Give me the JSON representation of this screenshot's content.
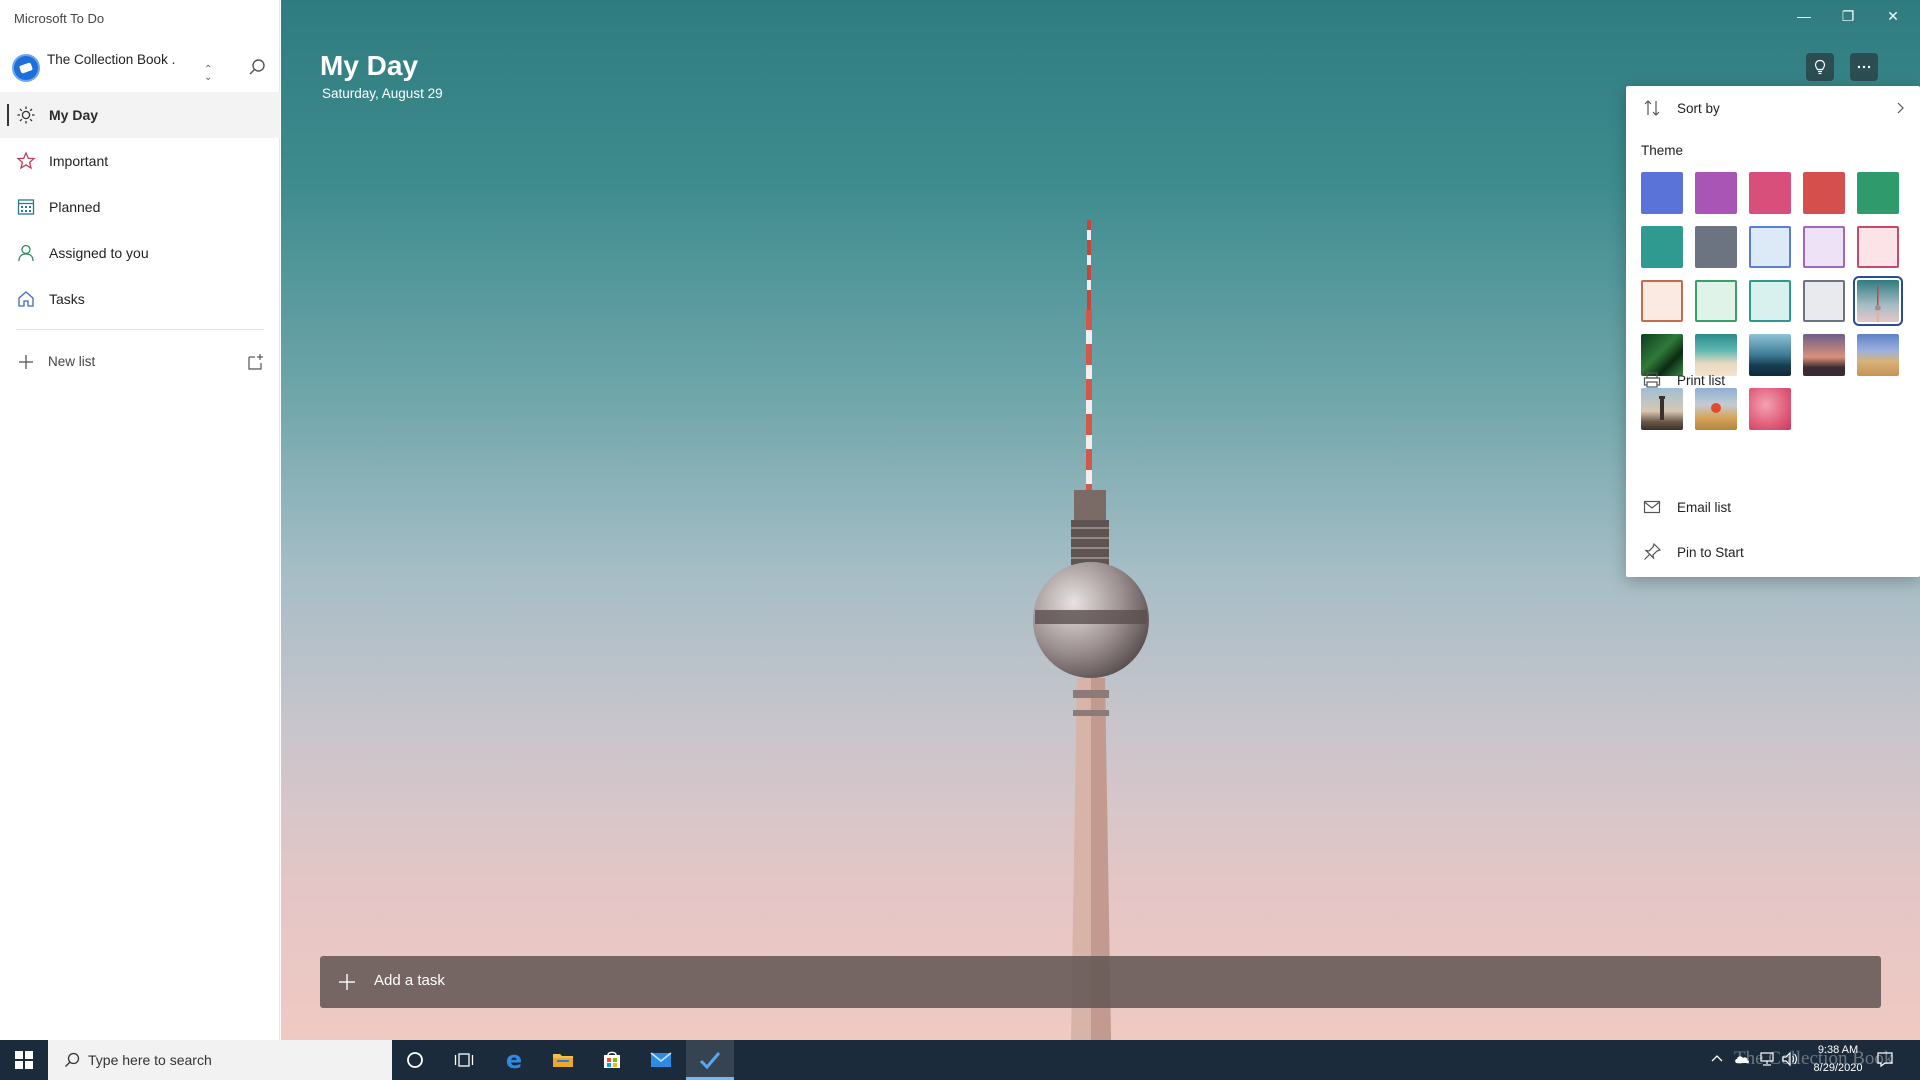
{
  "app": {
    "title": "Microsoft To Do"
  },
  "account": {
    "name": "The Collection Book ."
  },
  "nav": {
    "items": [
      {
        "label": "My Day",
        "icon": "sun-icon",
        "active": true
      },
      {
        "label": "Important",
        "icon": "star-icon",
        "active": false
      },
      {
        "label": "Planned",
        "icon": "calendar-icon",
        "active": false
      },
      {
        "label": "Assigned to you",
        "icon": "person-icon",
        "active": false
      },
      {
        "label": "Tasks",
        "icon": "home-icon",
        "active": false
      }
    ],
    "new_list_label": "New list"
  },
  "main": {
    "title": "My Day",
    "date": "Saturday, August 29",
    "add_task_label": "Add a task"
  },
  "menu": {
    "sort_by_label": "Sort by",
    "theme_label": "Theme",
    "print_label": "Print list",
    "email_label": "Email list",
    "pin_label": "Pin to Start",
    "theme_colors": {
      "row1": [
        "#5a73d8",
        "#a855b5",
        "#d94f7b",
        "#d64f4f",
        "#2f9a6c"
      ],
      "row2": [
        "#2f9b90",
        "#6b7480",
        "#dce9f7",
        "#eee3f6",
        "#fbe3e8"
      ],
      "row3": [
        "#faeae2",
        "#dff3e8",
        "#d9f1ee",
        "#e8eaee"
      ],
      "row3_borders": [
        "#c66a4e",
        "#3aa06a",
        "#2e9a8c",
        "#6b7480"
      ],
      "row2_borders": [
        "#5a7ed0",
        "#a068c0",
        "#c9496c"
      ]
    },
    "theme_images": [
      "tv-tower",
      "palm-leaves",
      "beach",
      "mountains",
      "sunset-palms",
      "desert",
      "lighthouse",
      "poppy-field",
      "pink-petals"
    ],
    "selected_theme": "tv-tower"
  },
  "taskbar": {
    "search_placeholder": "Type here to search",
    "time": "9:38 AM",
    "date": "8/29/2020",
    "watermark": "The Collection Book"
  }
}
